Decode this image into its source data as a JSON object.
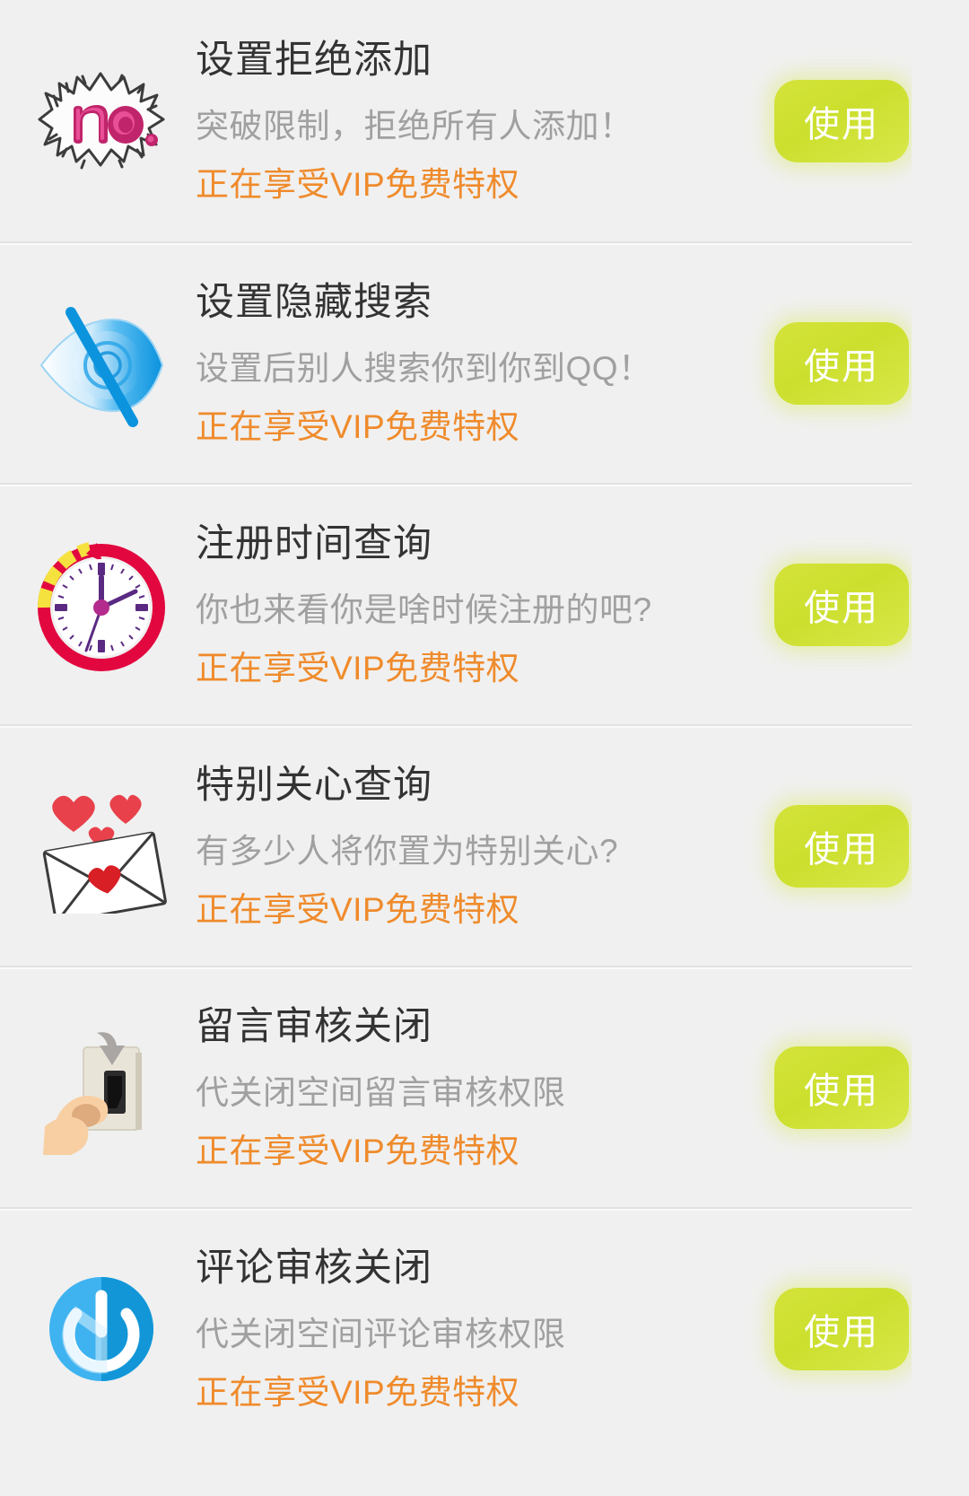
{
  "page": {
    "background_color": "#f0f0f0",
    "title_color": "#333333",
    "subtitle_color": "#a0a0a0",
    "vip_color": "#ef8b2c",
    "button_color": "#d2e236",
    "button_text_color": "#ffffff"
  },
  "rows": [
    {
      "icon": "no-speech-burst-icon",
      "title": "设置拒绝添加",
      "subtitle": "突破限制，拒绝所有人添加！",
      "vip_note": "正在享受VIP免费特权",
      "action_label": "使用"
    },
    {
      "icon": "hidden-eye-icon",
      "title": "设置隐藏搜索",
      "subtitle": "设置后别人搜索你到你到QQ！",
      "vip_note": "正在享受VIP免费特权",
      "action_label": "使用"
    },
    {
      "icon": "clock-rewind-icon",
      "title": "注册时间查询",
      "subtitle": "你也来看你是啥时候注册的吧?",
      "vip_note": "正在享受VIP免费特权",
      "action_label": "使用"
    },
    {
      "icon": "love-letter-icon",
      "title": "特别关心查询",
      "subtitle": "有多少人将你置为特别关心?",
      "vip_note": "正在享受VIP免费特权",
      "action_label": "使用"
    },
    {
      "icon": "hand-light-switch-icon",
      "title": "留言审核关闭",
      "subtitle": "代关闭空间留言审核权限",
      "vip_note": "正在享受VIP免费特权",
      "action_label": "使用"
    },
    {
      "icon": "power-button-icon",
      "title": "评论审核关闭",
      "subtitle": "代关闭空间评论审核权限",
      "vip_note": "正在享受VIP免费特权",
      "action_label": "使用"
    }
  ]
}
